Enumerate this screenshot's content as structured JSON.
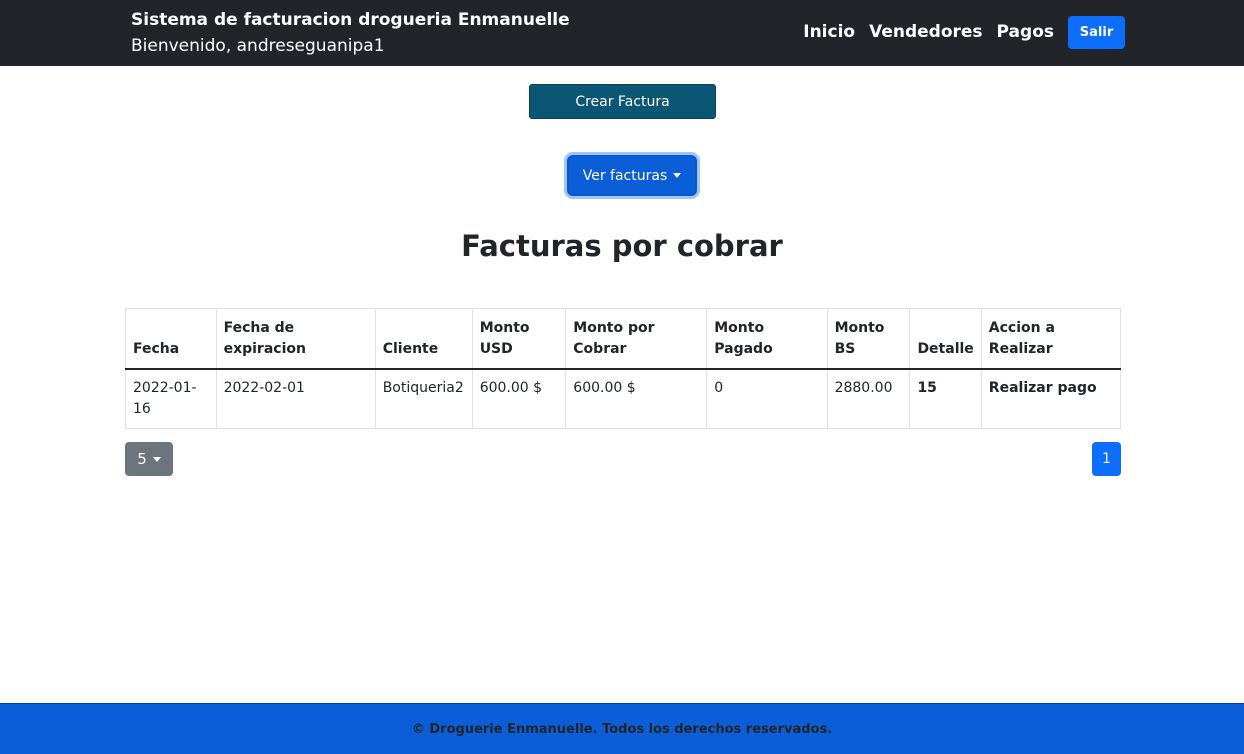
{
  "navbar": {
    "title": "Sistema de facturacion drogueria Enmanuelle",
    "welcome": "Bienvenido, andreseguanipa1",
    "links": [
      "Inicio",
      "Vendedores",
      "Pagos"
    ],
    "logout_label": "Salir"
  },
  "actions": {
    "create_label": "Crear Factura",
    "view_label": "Ver facturas"
  },
  "page_title": "Facturas por cobrar",
  "table": {
    "headers": [
      "Fecha",
      "Fecha de expiracion",
      "Cliente",
      "Monto USD",
      "Monto por Cobrar",
      "Monto Pagado",
      "Monto BS",
      "Detalle",
      "Accion a Realizar"
    ],
    "rows": [
      [
        "2022-01-16",
        "2022-02-01",
        "Botiqueria2",
        "600.00 $",
        "600.00 $",
        "0",
        "2880.00",
        "15",
        "Realizar pago"
      ]
    ]
  },
  "pagination": {
    "page_size": "5",
    "current_page": "1"
  },
  "footer": {
    "text": "© Droguerie Enmanuelle. Todos los derechos reservados."
  },
  "colors": {
    "navbar": "#212529",
    "primary": "#0d6efd",
    "create_button": "#0b5575",
    "footer": "#0b5ed7"
  }
}
